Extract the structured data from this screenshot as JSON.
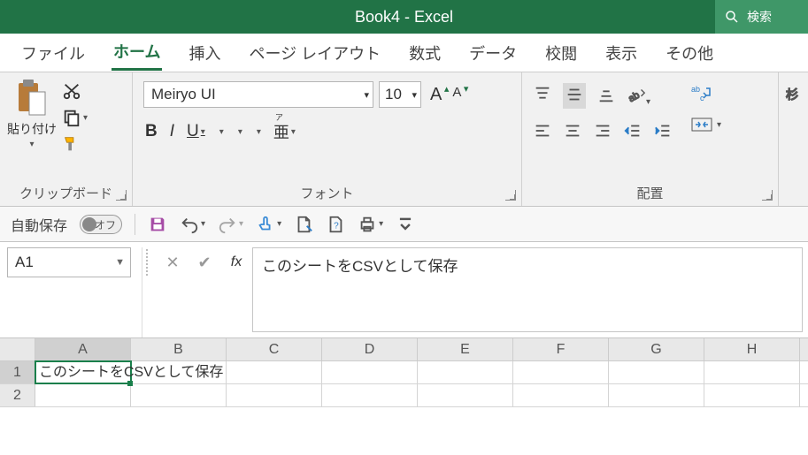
{
  "titlebar": {
    "title": "Book4  -  Excel",
    "search_placeholder": "検索"
  },
  "tabs": {
    "file": "ファイル",
    "home": "ホーム",
    "insert": "挿入",
    "page_layout": "ページ レイアウト",
    "formulas": "数式",
    "data": "データ",
    "review": "校閲",
    "view": "表示",
    "more": "その他",
    "active": "home"
  },
  "ribbon": {
    "clipboard": {
      "paste_label": "貼り付け",
      "group_label": "クリップボード"
    },
    "font": {
      "font_name": "Meiryo UI",
      "font_size": "10",
      "bold": "B",
      "italic": "I",
      "underline": "U",
      "group_label": "フォント"
    },
    "alignment": {
      "group_label": "配置"
    }
  },
  "qat": {
    "autosave_label": "自動保存",
    "autosave_state": "オフ"
  },
  "formula_bar": {
    "name_box": "A1",
    "fx_label": "fx",
    "content": "このシートをCSVとして保存"
  },
  "grid": {
    "columns": [
      "A",
      "B",
      "C",
      "D",
      "E",
      "F",
      "G",
      "H"
    ],
    "rows": [
      {
        "num": "1",
        "cells": [
          "このシートをCSVとして保存",
          "",
          "",
          "",
          "",
          "",
          "",
          ""
        ]
      },
      {
        "num": "2",
        "cells": [
          "",
          "",
          "",
          "",
          "",
          "",
          "",
          ""
        ]
      }
    ],
    "selected": {
      "row": 0,
      "col": 0
    }
  }
}
